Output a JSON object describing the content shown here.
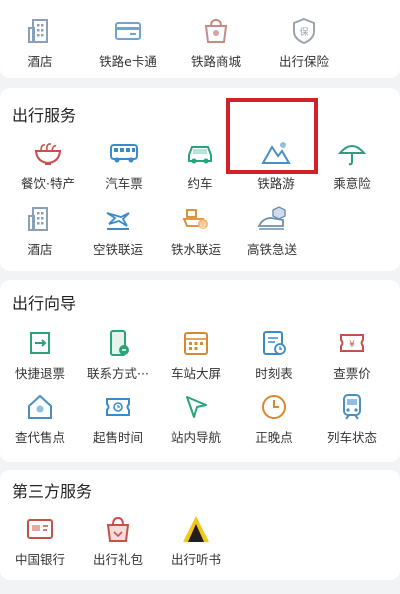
{
  "top_row": [
    {
      "label": "酒店",
      "icon": "hotel-building-icon"
    },
    {
      "label": "铁路e卡通",
      "icon": "railway-card-icon"
    },
    {
      "label": "铁路商城",
      "icon": "mall-shopping-bag-icon"
    },
    {
      "label": "出行保险",
      "icon": "insurance-shield-icon"
    }
  ],
  "travel_services": {
    "title": "出行服务",
    "items": [
      {
        "label": "餐饮·特产",
        "icon": "noodle-bowl-icon"
      },
      {
        "label": "汽车票",
        "icon": "bus-icon"
      },
      {
        "label": "约车",
        "icon": "car-icon"
      },
      {
        "label": "铁路游",
        "icon": "mountain-travel-icon"
      },
      {
        "label": "乘意险",
        "icon": "umbrella-icon"
      },
      {
        "label": "酒店",
        "icon": "hotel-building-icon"
      },
      {
        "label": "空铁联运",
        "icon": "air-rail-icon"
      },
      {
        "label": "铁水联运",
        "icon": "rail-water-icon"
      },
      {
        "label": "高铁急送",
        "icon": "express-delivery-icon"
      }
    ]
  },
  "travel_guide": {
    "title": "出行向导",
    "items": [
      {
        "label": "快捷退票",
        "icon": "refund-ticket-icon"
      },
      {
        "label": "联系方式···",
        "icon": "phone-contact-icon"
      },
      {
        "label": "车站大屏",
        "icon": "station-screen-icon"
      },
      {
        "label": "时刻表",
        "icon": "timetable-icon"
      },
      {
        "label": "查票价",
        "icon": "ticket-price-icon"
      },
      {
        "label": "查代售点",
        "icon": "agency-location-icon"
      },
      {
        "label": "起售时间",
        "icon": "sale-time-icon"
      },
      {
        "label": "站内导航",
        "icon": "navigation-arrow-icon"
      },
      {
        "label": "正晚点",
        "icon": "clock-icon"
      },
      {
        "label": "列车状态",
        "icon": "train-status-icon"
      }
    ]
  },
  "third_party": {
    "title": "第三方服务",
    "items": [
      {
        "label": "中国银行",
        "icon": "bank-card-icon"
      },
      {
        "label": "出行礼包",
        "icon": "gift-bag-icon"
      },
      {
        "label": "出行听书",
        "icon": "audiobook-icon"
      }
    ]
  }
}
